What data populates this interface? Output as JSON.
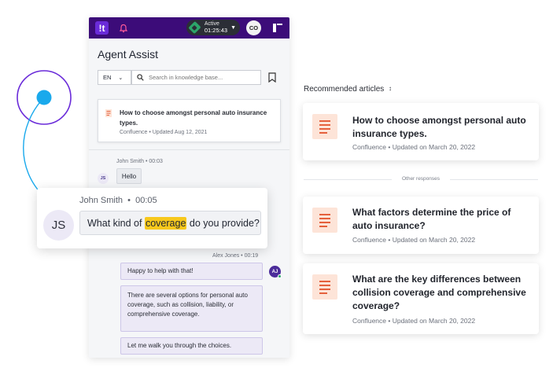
{
  "topbar": {
    "logo_text": "!t",
    "status_label": "Active",
    "status_time": "01:25:43",
    "user_initials": "CO"
  },
  "panel": {
    "title": "Agent Assist",
    "language": "EN",
    "search_placeholder": "Search in knowledge base..."
  },
  "kb_result": {
    "title": "How to choose amongst personal auto insurance types.",
    "meta": "Confluence • Updated Aug 12, 2021"
  },
  "conversation": {
    "customer_meta": "John Smith • 00:03",
    "customer_initials": "JS",
    "customer_message": "Hello",
    "agent_meta": "Alex Jones • 00:19",
    "agent_initials": "AJ",
    "agent_messages": [
      "Happy to help with that!",
      "There are several options for personal auto coverage, such as collision, liability, or comprehensive coverage.",
      "Let me walk you through the choices."
    ]
  },
  "focus_message": {
    "author": "John Smith",
    "time": "00:05",
    "initials": "JS",
    "text_before": "What kind of",
    "highlight": "coverage",
    "text_after": "do you provide?"
  },
  "recommended": {
    "title": "Recommended articles",
    "other_label": "Other responses",
    "articles": [
      {
        "title": "How to choose amongst personal auto insurance types.",
        "meta": "Confluence • Updated on March 20, 2022"
      },
      {
        "title": "What factors determine the price of auto insurance?",
        "meta": "Confluence • Updated on March 20, 2022"
      },
      {
        "title": "What are the key differences between collision coverage and comprehensive coverage?",
        "meta": "Confluence • Updated on March 20, 2022"
      }
    ]
  },
  "colors": {
    "topbar": "#3c0c79",
    "accent_purple": "#6a2bd9",
    "highlight": "#f7c81c",
    "article_icon": "#e5603c",
    "status_green": "#2ca56a"
  },
  "icons": {
    "bell": "bell-icon",
    "search": "search-icon",
    "bookmark": "bookmark-icon",
    "layout": "panel-layout-icon",
    "document": "document-icon",
    "collapse": "collapse-icon"
  }
}
